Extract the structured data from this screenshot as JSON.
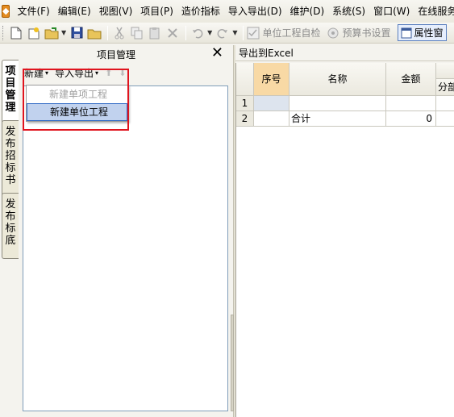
{
  "menubar": {
    "app_icon": "app-logo-icon",
    "items": [
      "文件(F)",
      "编辑(E)",
      "视图(V)",
      "项目(P)",
      "造价指标",
      "导入导出(D)",
      "维护(D)",
      "系统(S)",
      "窗口(W)",
      "在线服务"
    ]
  },
  "toolbar": {
    "unit_check": "单位工程自检",
    "budget_settings": "预算书设置",
    "properties": "属性窗"
  },
  "side_tabs": [
    "项目管理",
    "发布招标书",
    "发布标底"
  ],
  "panel": {
    "title": "项目管理",
    "close_glyph": "✕",
    "new_label": "新建",
    "import_export_label": "导入导出",
    "caret": "▾",
    "up_arrow": "⬆",
    "down_arrow": "⬇"
  },
  "dropdown": {
    "items": [
      {
        "label": "新建单项工程",
        "state": "disabled"
      },
      {
        "label": "新建单位工程",
        "state": "hover"
      }
    ]
  },
  "grid": {
    "export_label": "导出到Excel",
    "headers": {
      "seq": "序号",
      "name": "名称",
      "amount": "金额",
      "partial": "分部"
    },
    "rows": [
      {
        "num": "1",
        "seq": "",
        "name": "",
        "amount": ""
      },
      {
        "num": "2",
        "seq": "",
        "name": "合计",
        "amount": "0"
      }
    ]
  },
  "colors": {
    "highlight": "#e0141e",
    "hover_bg": "#c1d2ee",
    "header_orange": "#f8d9a5"
  }
}
